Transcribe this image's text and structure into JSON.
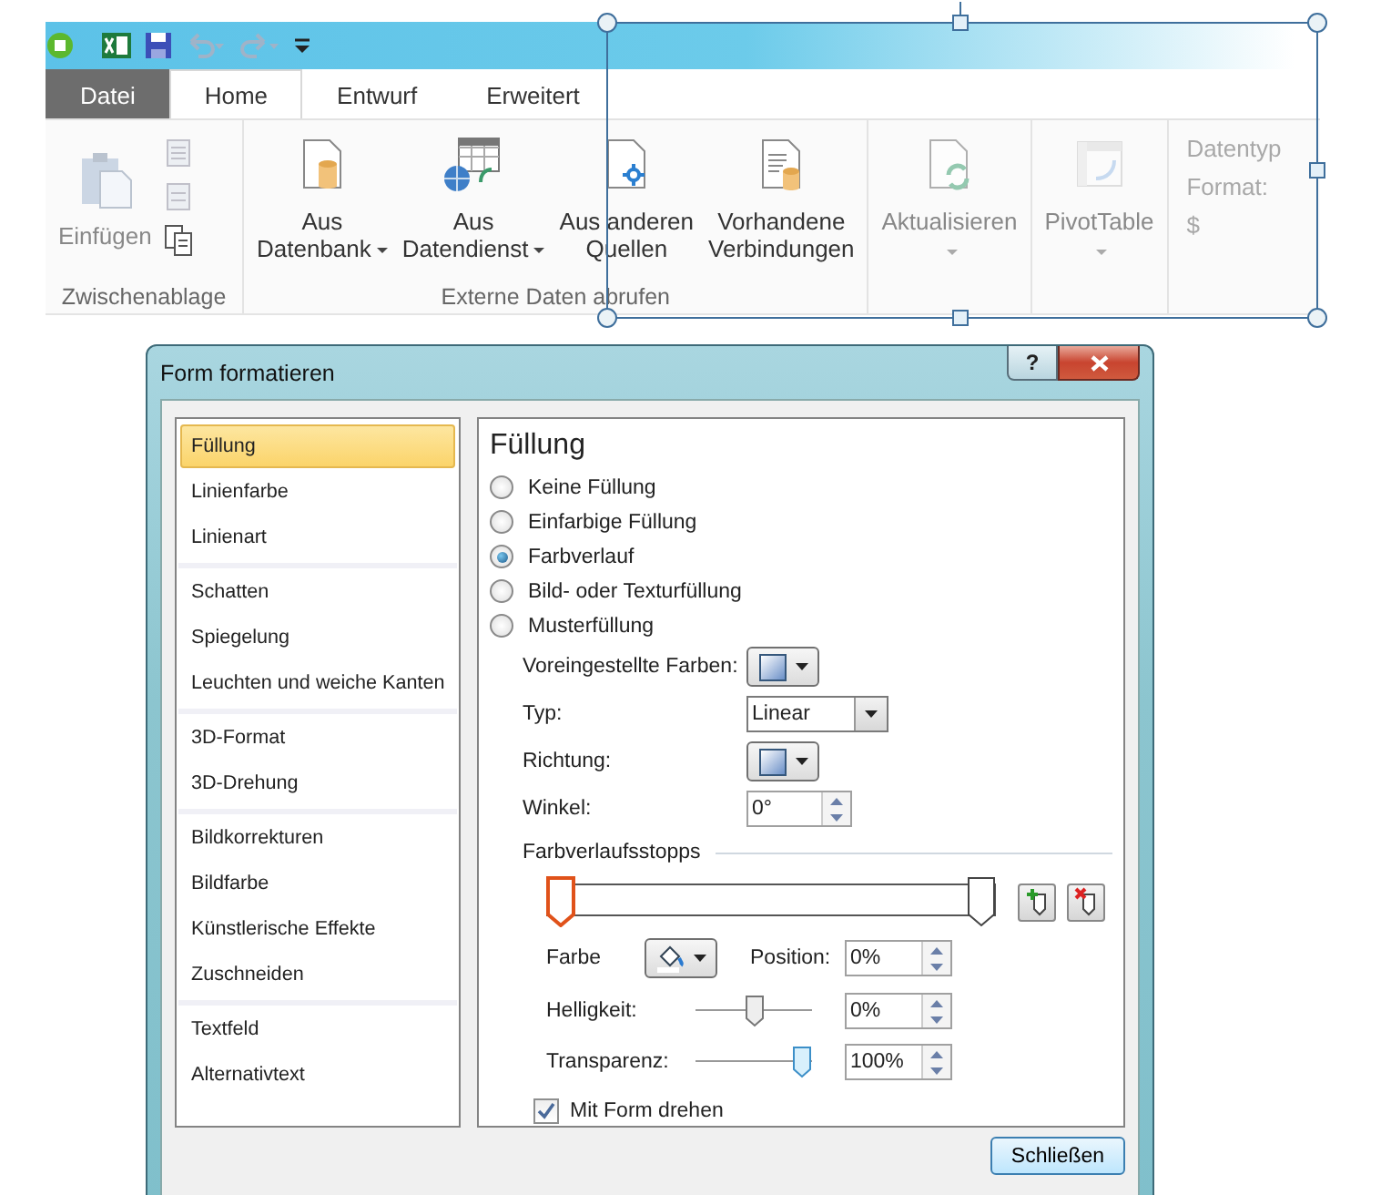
{
  "ribbon": {
    "tabs": [
      {
        "label": "Datei",
        "kind": "file",
        "selected": false
      },
      {
        "label": "Home",
        "kind": "tab",
        "selected": true
      },
      {
        "label": "Entwurf",
        "kind": "tab",
        "selected": false
      },
      {
        "label": "Erweitert",
        "kind": "tab",
        "selected": false
      }
    ],
    "groups": [
      {
        "label": "Zwischenablage",
        "kind": "clipboard",
        "buttons": [
          {
            "lines": [
              "Einfügen"
            ],
            "dropdown": false,
            "disabled": true
          }
        ]
      },
      {
        "label": "Externe Daten abrufen",
        "kind": "large",
        "buttons": [
          {
            "lines": [
              "Aus",
              "Datenbank"
            ],
            "dropdown": true,
            "disabled": false
          },
          {
            "lines": [
              "Aus",
              "Datendienst"
            ],
            "dropdown": true,
            "disabled": false
          },
          {
            "lines": [
              "Aus anderen",
              "Quellen"
            ],
            "dropdown": false,
            "disabled": false
          },
          {
            "lines": [
              "Vorhandene",
              "Verbindungen"
            ],
            "dropdown": false,
            "disabled": false
          }
        ]
      },
      {
        "kind": "large",
        "buttons": [
          {
            "lines": [
              "Aktualisieren"
            ],
            "dropdown": true,
            "disabled": true
          }
        ]
      },
      {
        "kind": "large",
        "buttons": [
          {
            "lines": [
              "PivotTable"
            ],
            "dropdown": true,
            "disabled": true
          }
        ]
      },
      {
        "kind": "faded",
        "items": [
          "Datentyp",
          "Format:",
          "$"
        ]
      }
    ]
  },
  "dialog": {
    "title": "Form formatieren",
    "help_button": "?",
    "sidebar": {
      "groups": [
        {
          "items": [
            {
              "label": "Füllung",
              "selected": true
            },
            {
              "label": "Linienfarbe",
              "selected": false
            },
            {
              "label": "Linienart",
              "selected": false
            }
          ]
        },
        {
          "items": [
            {
              "label": "Schatten",
              "selected": false
            },
            {
              "label": "Spiegelung",
              "selected": false
            },
            {
              "label": "Leuchten und weiche Kanten",
              "selected": false
            }
          ]
        },
        {
          "items": [
            {
              "label": "3D-Format",
              "selected": false
            },
            {
              "label": "3D-Drehung",
              "selected": false
            }
          ]
        },
        {
          "items": [
            {
              "label": "Bildkorrekturen",
              "selected": false
            },
            {
              "label": "Bildfarbe",
              "selected": false
            },
            {
              "label": "Künstlerische Effekte",
              "selected": false
            },
            {
              "label": "Zuschneiden",
              "selected": false
            }
          ]
        },
        {
          "items": [
            {
              "label": "Textfeld",
              "selected": false
            },
            {
              "label": "Alternativtext",
              "selected": false
            }
          ]
        }
      ]
    },
    "panel": {
      "heading": "Füllung",
      "fill_options": [
        {
          "label": "Keine Füllung",
          "selected": false
        },
        {
          "label": "Einfarbige Füllung",
          "selected": false
        },
        {
          "label": "Farbverlauf",
          "selected": true
        },
        {
          "label": "Bild- oder Texturfüllung",
          "selected": false
        },
        {
          "label": "Musterfüllung",
          "selected": false
        }
      ],
      "settings": [
        {
          "kind": "preset",
          "label": "Voreingestellte Farben:"
        },
        {
          "kind": "select",
          "label": "Typ:",
          "value": "Linear"
        },
        {
          "kind": "preset",
          "label": "Richtung:"
        },
        {
          "kind": "spinner",
          "label": "Winkel:",
          "value": "0°"
        }
      ],
      "stops_title": "Farbverlaufsstopps",
      "stops": [
        {
          "level": 0,
          "selected": true
        },
        {
          "level": 1,
          "selected": false
        }
      ],
      "color_label": "Farbe",
      "position_label": "Position:",
      "position_value": "0%",
      "sliders": [
        {
          "label": "Helligkeit:",
          "level": 0.5,
          "value": "0%"
        },
        {
          "label": "Transparenz:",
          "level": 1,
          "value": "100%"
        }
      ],
      "rotate_with_shape": {
        "label": "Mit Form drehen",
        "checked": true
      }
    },
    "buttons": [
      "Schließen"
    ]
  }
}
